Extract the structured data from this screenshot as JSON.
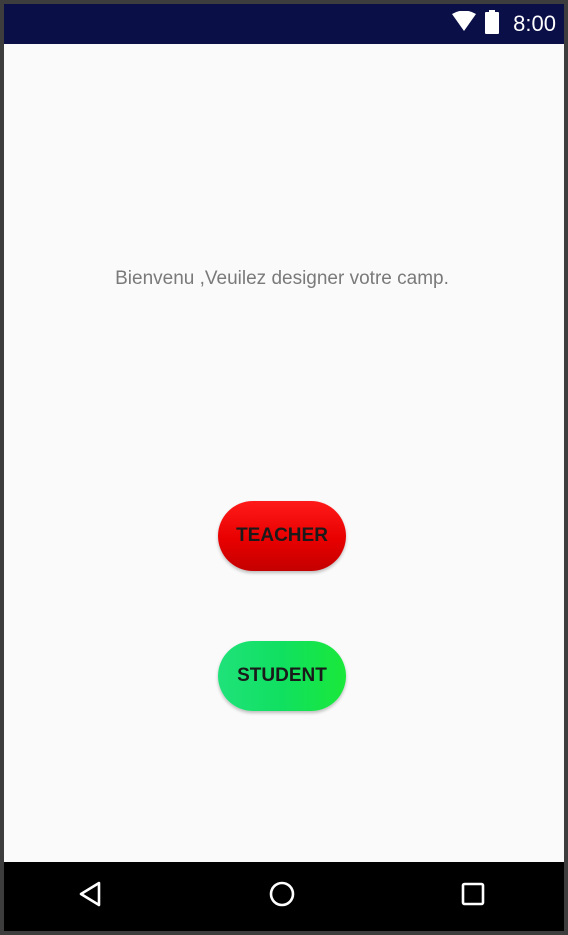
{
  "status_bar": {
    "time": "8:00",
    "icons": [
      "wifi-icon",
      "battery-icon"
    ],
    "background": "#0a0f47"
  },
  "main": {
    "welcome_text": "Bienvenu ,Veuilez designer votre camp.",
    "teacher_button": {
      "label": "TEACHER",
      "color": "#e80000"
    },
    "student_button": {
      "label": "STUDENT",
      "color": "#10e060"
    }
  },
  "nav_bar": {
    "icons": [
      "back-icon",
      "home-icon",
      "recent-apps-icon"
    ]
  }
}
